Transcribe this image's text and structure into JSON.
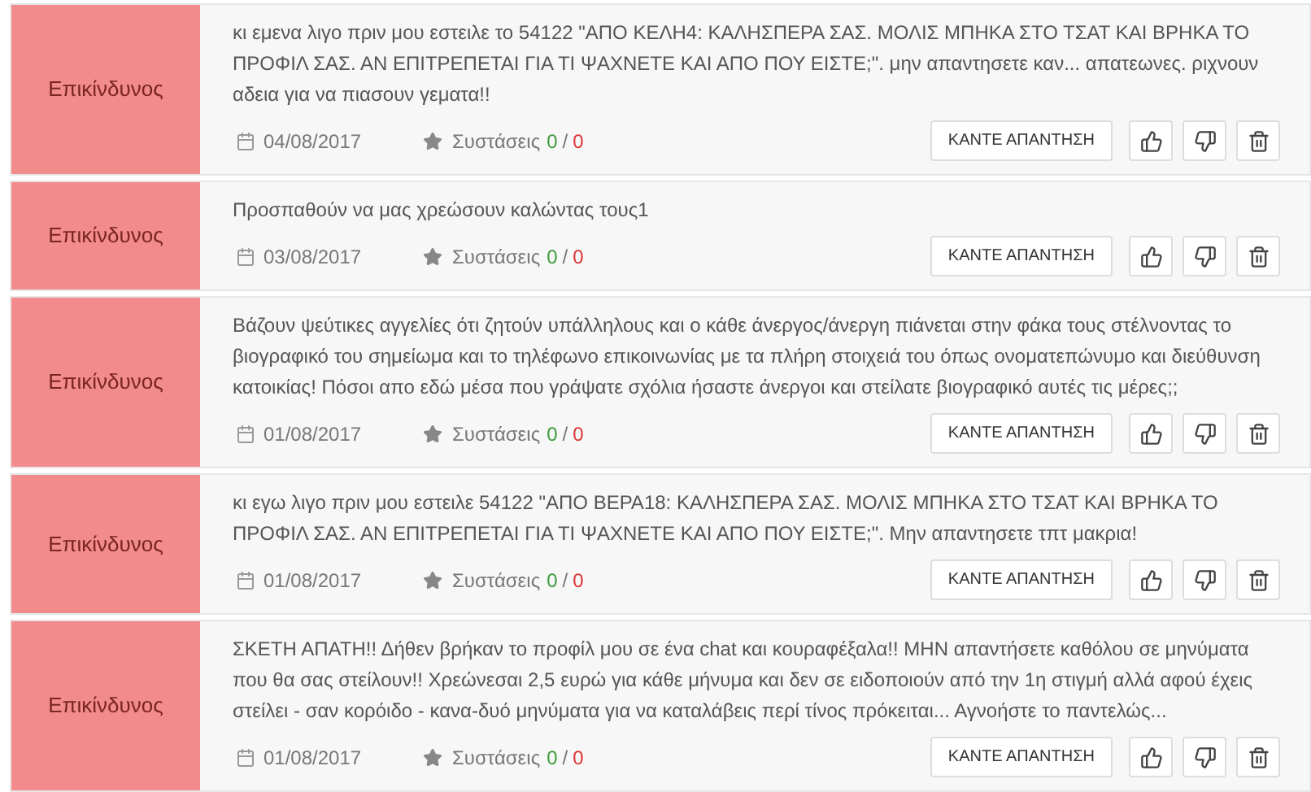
{
  "comments": [
    {
      "rating": "Επικίνδυνος",
      "color": "#f28b8b",
      "text": "κι εμενα λιγο πριν μου εστειλε το 54122 \"ΑΠΟ ΚΕΛΗ4: ΚΑΛΗΣΠΕΡΑ ΣΑΣ. ΜΟΛΙΣ ΜΠΗΚΑ ΣΤΟ ΤΣΑΤ ΚΑΙ ΒΡΗΚΑ ΤΟ ΠΡΟΦΙΛ ΣΑΣ. ΑΝ ΕΠΙΤΡΕΠΕΤΑΙ ΓΙΑ ΤΙ ΨΑΧΝΕΤΕ ΚΑΙ ΑΠΟ ΠΟΥ ΕΙΣΤΕ;\". μην απαντησετε καν... απατεωνες. ριχνουν αδεια για να πιασουν γεματα!!",
      "date": "04/08/2017",
      "votes_label": "Συστάσεις",
      "upvotes": "0",
      "separator": "/",
      "downvotes": "0",
      "reply_button": "ΚΑΝΤΕ ΑΠΑΝΤΗΣΗ"
    },
    {
      "rating": "Επικίνδυνος",
      "color": "#f28b8b",
      "text": "Προσπαθούν να μας χρεώσουν καλώντας τους1",
      "date": "03/08/2017",
      "votes_label": "Συστάσεις",
      "upvotes": "0",
      "separator": "/",
      "downvotes": "0",
      "reply_button": "ΚΑΝΤΕ ΑΠΑΝΤΗΣΗ"
    },
    {
      "rating": "Επικίνδυνος",
      "color": "#f28b8b",
      "text": "Βάζουν ψεύτικες αγγελίες ότι ζητούν υπάλληλους και ο κάθε άνεργος/άνεργη πιάνεται στην φάκα τους στέλνοντας το βιογραφικό του σημείωμα και το τηλέφωνο επικοινωνίας με τα πλήρη στοιχειά του όπως ονοματεπώνυμο και διεύθυνση κατοικίας! Πόσοι απο εδώ μέσα που γράψατε σχόλια ήσαστε άνεργοι και στείλατε βιογραφικό αυτές τις μέρες;;",
      "date": "01/08/2017",
      "votes_label": "Συστάσεις",
      "upvotes": "0",
      "separator": "/",
      "downvotes": "0",
      "reply_button": "ΚΑΝΤΕ ΑΠΑΝΤΗΣΗ"
    },
    {
      "rating": "Επικίνδυνος",
      "color": "#f28b8b",
      "text": "κι εγω λιγο πριν μου εστειλε 54122 \"ΑΠΟ ΒΕΡΑ18: ΚΑΛΗΣΠΕΡΑ ΣΑΣ. ΜΟΛΙΣ ΜΠΗΚΑ ΣΤΟ ΤΣΑΤ ΚΑΙ ΒΡΗΚΑ ΤΟ ΠΡΟΦΙΛ ΣΑΣ. ΑΝ ΕΠΙΤΡΕΠΕΤΑΙ ΓΙΑ ΤΙ ΨΑΧΝΕΤΕ ΚΑΙ ΑΠΟ ΠΟΥ ΕΙΣΤΕ;\". Μην απαντησετε τπτ μακρια!",
      "date": "01/08/2017",
      "votes_label": "Συστάσεις",
      "upvotes": "0",
      "separator": "/",
      "downvotes": "0",
      "reply_button": "ΚΑΝΤΕ ΑΠΑΝΤΗΣΗ"
    },
    {
      "rating": "Επικίνδυνος",
      "color": "#f28b8b",
      "text": "ΣΚΕΤΗ ΑΠΑΤΗ!! Δήθεν βρήκαν το προφίλ μου σε ένα chat και κουραφέξαλα!! ΜΗΝ απαντήσετε καθόλου σε μηνύματα που θα σας στείλουν!! Χρεώνεσαι 2,5 ευρώ για κάθε μήνυμα και δεν σε ειδοποιούν από την 1η στιγμή αλλά αφού έχεις στείλει - σαν κορόιδο - κανα-δυό μηνύματα για να καταλάβεις περί τίνος πρόκειται... Αγνοήστε το παντελώς...",
      "date": "01/08/2017",
      "votes_label": "Συστάσεις",
      "upvotes": "0",
      "separator": "/",
      "downvotes": "0",
      "reply_button": "ΚΑΝΤΕ ΑΠΑΝΤΗΣΗ"
    }
  ]
}
